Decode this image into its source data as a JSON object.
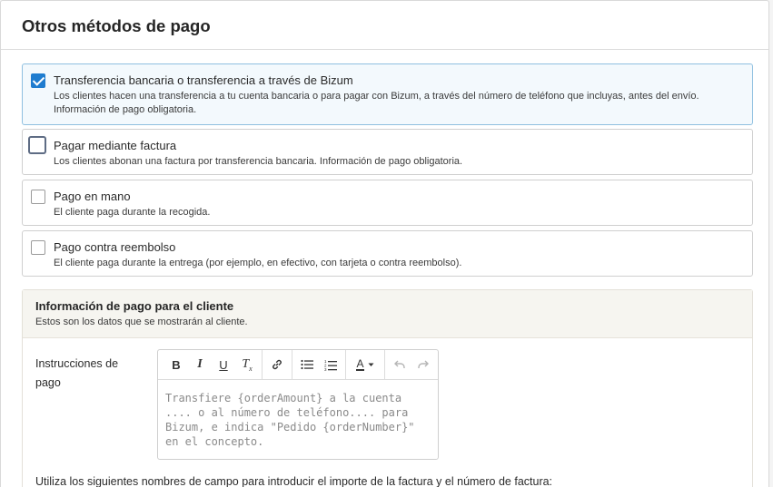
{
  "panel": {
    "title": "Otros métodos de pago"
  },
  "options": [
    {
      "title": "Transferencia bancaria o transferencia a través de Bizum",
      "description": "Los clientes hacen una transferencia a tu cuenta bancaria o para pagar con Bizum, a través del número de teléfono que incluyas, antes del envío. Información de pago obligatoria.",
      "checked": true
    },
    {
      "title": "Pagar mediante factura",
      "description": "Los clientes abonan una factura por transferencia bancaria. Información de pago obligatoria.",
      "checked": false
    },
    {
      "title": "Pago en mano",
      "description": "El cliente paga durante la recogida.",
      "checked": false
    },
    {
      "title": "Pago contra reembolso",
      "description": "El cliente paga durante la entrega (por ejemplo, en efectivo, con tarjeta o contra reembolso).",
      "checked": false
    }
  ],
  "info": {
    "title": "Información de pago para el cliente",
    "subtitle": "Estos son los datos que se mostrarán al cliente.",
    "field_label": "Instrucciones de pago",
    "editor_placeholder": "Transfiere {orderAmount} a la cuenta .... o al número de teléfono.... para Bizum, e indica \"Pedido {orderNumber}\" en el concepto.",
    "bottom_note": "Utiliza los siguientes nombres de campo para introducir el importe de la factura y el número de factura:"
  },
  "toolbar": {
    "bold": "B",
    "italic": "I",
    "underline": "U",
    "clear_format": "T",
    "clear_format_sub": "x",
    "text_color": "A"
  },
  "colors": {
    "accent": "#1f7ccf",
    "selected_bg": "#f3f9fd",
    "info_head_bg": "#f6f5f0"
  }
}
